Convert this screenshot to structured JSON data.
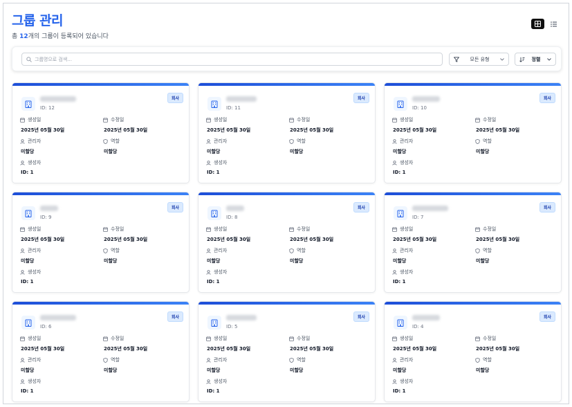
{
  "page": {
    "title": "그룹 관리",
    "subtitle_prefix": "총 ",
    "count": "12",
    "subtitle_suffix": "개의 그룹이 등록되어 있습니다"
  },
  "view_toggle": {
    "grid_icon": "grid-icon",
    "list_icon": "list-icon",
    "active": "grid"
  },
  "search": {
    "placeholder": "그룹명으로 검색...",
    "value": ""
  },
  "filter": {
    "label": "모든 유형"
  },
  "sort": {
    "label": "정렬"
  },
  "labels": {
    "created": "생성일",
    "updated": "수정일",
    "manager": "관리자",
    "role": "역할",
    "creator": "생성자"
  },
  "colors": {
    "accent": "#2563eb",
    "badge_bg": "#dbeafe",
    "active_toggle": "#0f0f0f"
  },
  "cards": [
    {
      "id": "ID: 12",
      "badge": "회사",
      "created": "2025년 05월 30일",
      "updated": "2025년 05월 30일",
      "manager": "미할당",
      "role": "미할당",
      "creator": "ID: 1"
    },
    {
      "id": "ID: 11",
      "badge": "회사",
      "created": "2025년 05월 30일",
      "updated": "2025년 05월 30일",
      "manager": "미할당",
      "role": "미할당",
      "creator": "ID: 1"
    },
    {
      "id": "ID: 10",
      "badge": "회사",
      "created": "2025년 05월 30일",
      "updated": "2025년 05월 30일",
      "manager": "미할당",
      "role": "미할당",
      "creator": "ID: 1"
    },
    {
      "id": "ID: 9",
      "badge": "회사",
      "created": "2025년 05월 30일",
      "updated": "2025년 05월 30일",
      "manager": "미할당",
      "role": "미할당",
      "creator": "ID: 1"
    },
    {
      "id": "ID: 8",
      "badge": "회사",
      "created": "2025년 05월 30일",
      "updated": "2025년 05월 30일",
      "manager": "미할당",
      "role": "미할당",
      "creator": "ID: 1"
    },
    {
      "id": "ID: 7",
      "badge": "회사",
      "created": "2025년 05월 30일",
      "updated": "2025년 05월 30일",
      "manager": "미할당",
      "role": "미할당",
      "creator": "ID: 1"
    },
    {
      "id": "ID: 6",
      "badge": "회사",
      "created": "2025년 05월 30일",
      "updated": "2025년 05월 30일",
      "manager": "미할당",
      "role": "미할당",
      "creator": "ID: 1"
    },
    {
      "id": "ID: 5",
      "badge": "회사",
      "created": "2025년 05월 30일",
      "updated": "2025년 05월 30일",
      "manager": "미할당",
      "role": "미할당",
      "creator": "ID: 1"
    },
    {
      "id": "ID: 4",
      "badge": "회사",
      "created": "2025년 05월 30일",
      "updated": "2025년 05월 30일",
      "manager": "미할당",
      "role": "미할당",
      "creator": "ID: 1"
    }
  ]
}
